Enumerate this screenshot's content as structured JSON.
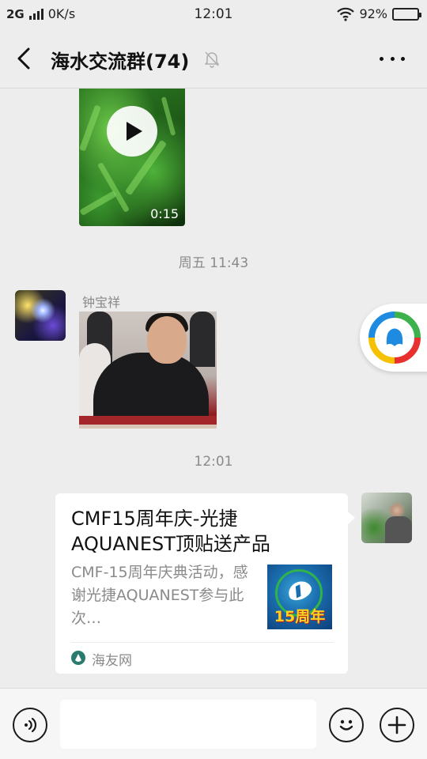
{
  "status_bar": {
    "network": "2G",
    "speed": "0K/s",
    "time": "12:01",
    "battery": "92%",
    "battery_level": 0.92
  },
  "header": {
    "title": "海水交流群(74)",
    "icons": [
      "back-icon",
      "mute-bell-icon",
      "more-icon"
    ]
  },
  "messages": {
    "video": {
      "duration": "0:15",
      "icon": "play-icon"
    },
    "time_1": "周五 11:43",
    "image_msg": {
      "sender": "钟宝祥"
    },
    "time_2": "12:01",
    "link_card": {
      "title": "CMF15周年庆-光捷AQUANEST顶贴送产品",
      "description": "CMF-15周年庆典活动，感谢光捷AQUANEST参与此次…",
      "thumb_text": "15周年",
      "source": "海友网"
    }
  },
  "floating": {
    "icon": "tencent-news-icon"
  },
  "input_bar": {
    "placeholder": "",
    "icons": [
      "voice-icon",
      "emoji-icon",
      "plus-icon"
    ]
  },
  "colors": {
    "background": "#ededed",
    "bubble": "#ffffff",
    "muted_text": "#8a8a8a"
  }
}
